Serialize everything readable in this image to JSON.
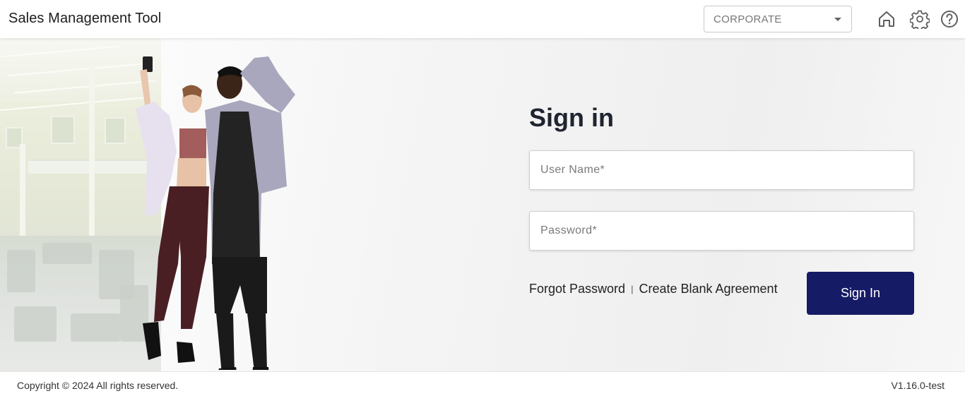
{
  "header": {
    "app_title": "Sales Management Tool",
    "club_selector": {
      "selected": "CORPORATE"
    },
    "icons": [
      "home-icon",
      "settings-gear-icon",
      "help-icon"
    ]
  },
  "signin": {
    "title": "Sign in",
    "username_placeholder": "User Name*",
    "password_placeholder": "Password*",
    "forgot_password": "Forgot Password",
    "separator": "|",
    "create_blank_agreement": "Create Blank Agreement",
    "submit_label": "Sign In"
  },
  "footer": {
    "copyright": "Copyright © 2024 All rights reserved.",
    "version": "V1.16.0-test"
  },
  "colors": {
    "primary_button": "#161b66",
    "title_text": "#1f2430"
  }
}
